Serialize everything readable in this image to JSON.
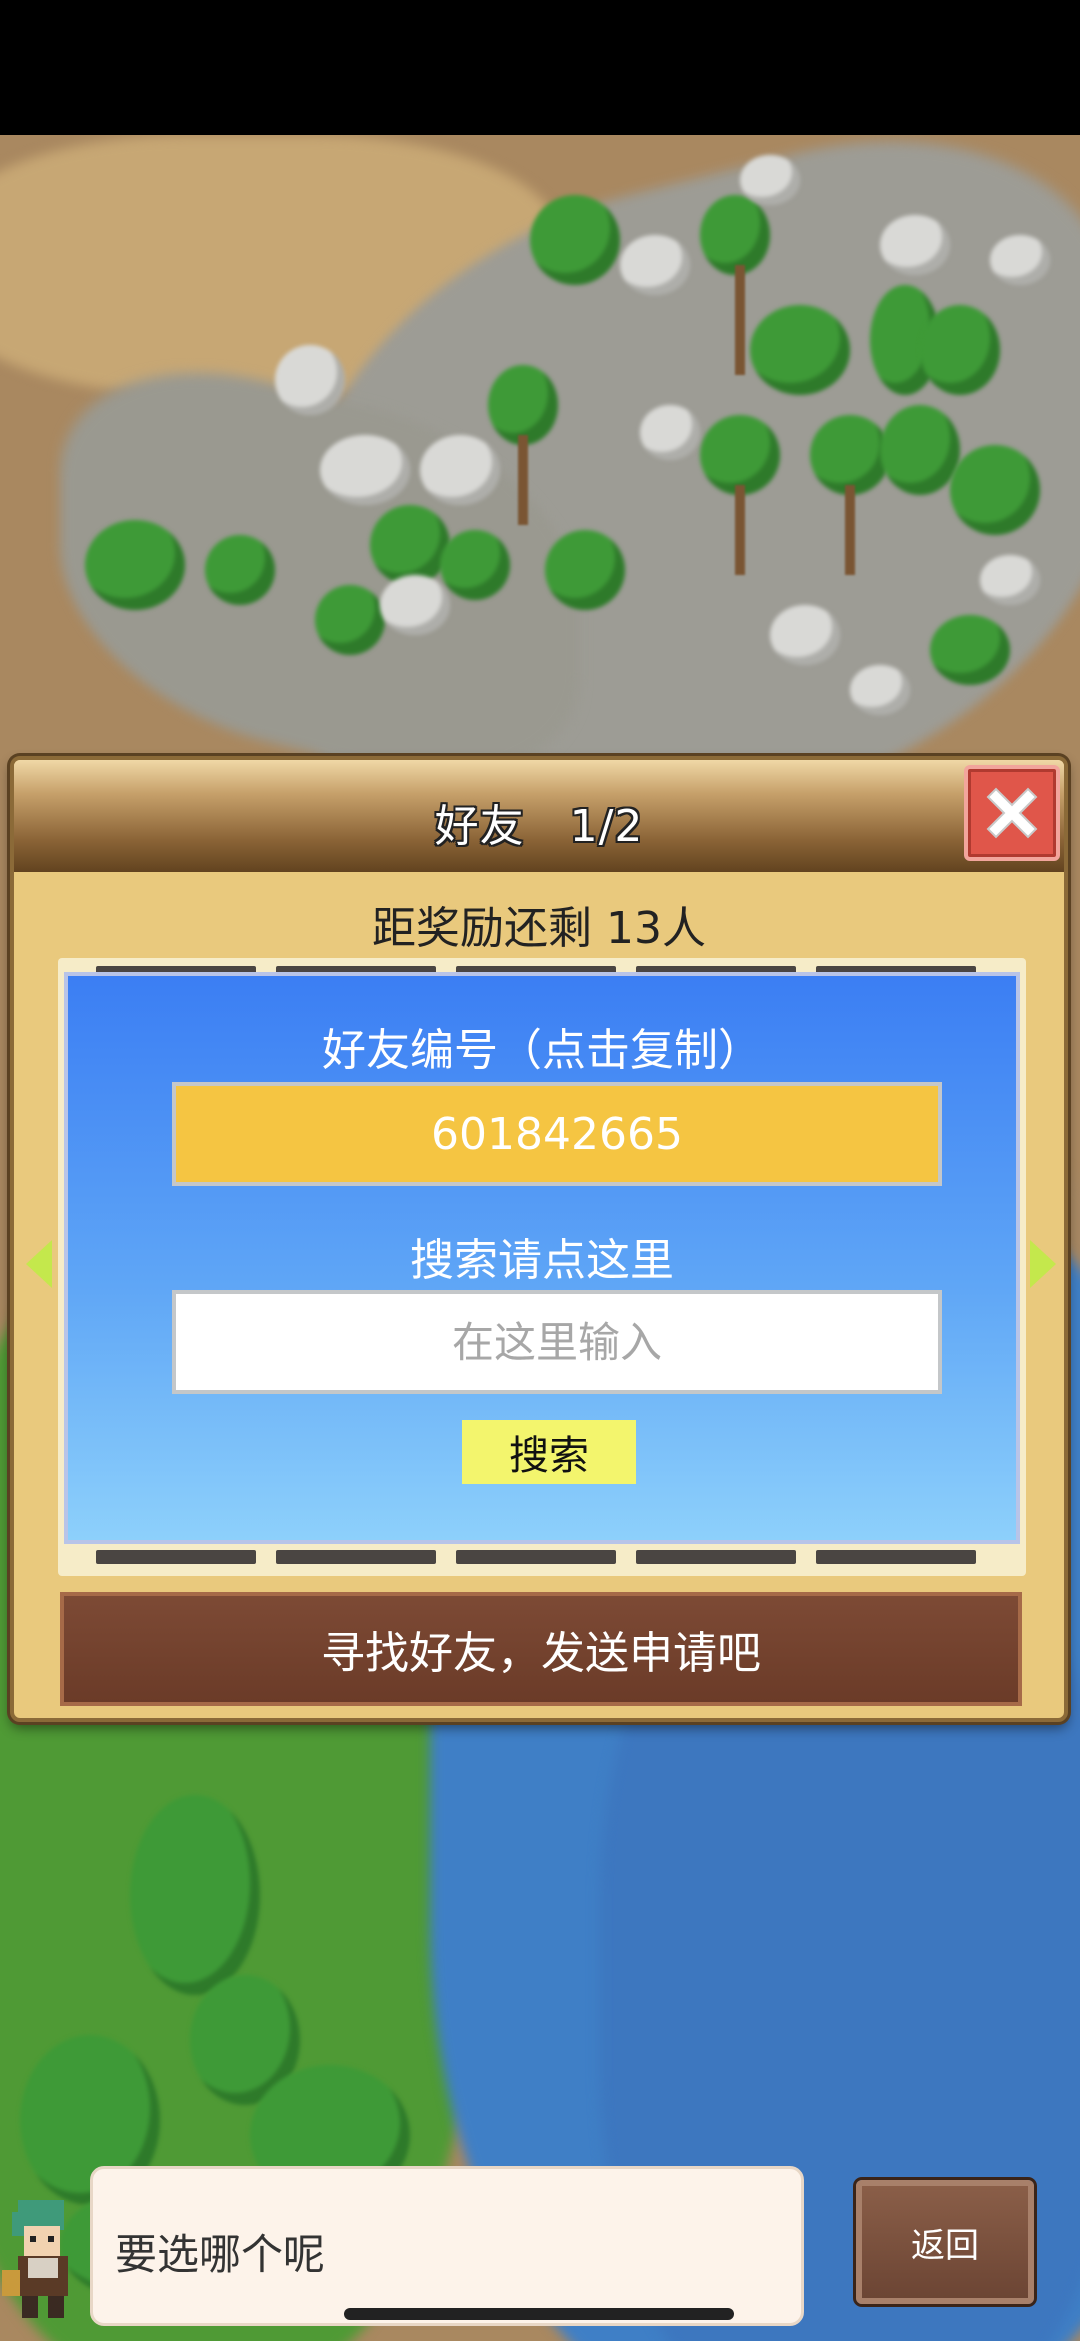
{
  "dialog": {
    "title": "好友　1/2",
    "reward_text": "距奖励还剩 13人",
    "friend_id_label": "好友编号（点击复制）",
    "friend_id": "601842665",
    "search_label": "搜索请点这里",
    "search_placeholder": "在这里输入",
    "search_button": "搜索",
    "send_request_button": "寻找好友，发送申请吧"
  },
  "message": {
    "text": "要选哪个呢"
  },
  "back_button": "返回",
  "colors": {
    "dialog_bg": "#e9c97d",
    "close_button": "#e0564a",
    "friend_id_box": "#f5c542",
    "search_button": "#f3f56d",
    "send_button": "#7d4a35",
    "panel_top": "#3b7ef3",
    "panel_bottom": "#8dd0fb"
  },
  "icons": {
    "close": "close-icon",
    "prev": "arrow-left-icon",
    "next": "arrow-right-icon"
  }
}
